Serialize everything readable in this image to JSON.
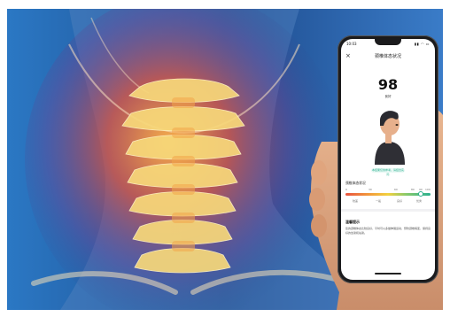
{
  "app": {
    "status_time": "10:03",
    "status_icons": "▮▮ ◠ ▭",
    "close_glyph": "×",
    "title": "颈椎体态状况",
    "score": "98",
    "score_label": "良好",
    "assess_note": "本结果仅供参考，请结合实际",
    "meter": {
      "title": "颈椎体态状况",
      "ticks": [
        "0",
        "30",
        "60",
        "80",
        "90",
        "100"
      ],
      "labels": [
        "较差",
        "一般",
        "良好",
        "优秀"
      ],
      "value": 98,
      "colors": [
        "#e8533f",
        "#f29a3b",
        "#f2d13f",
        "#86c96b",
        "#2bb08f"
      ]
    },
    "tips_title": "温馨提示",
    "tips_body": "您的颈椎体态比较良好，平时可以多做伸展运动，预防颈椎病变，保持良好的坐姿和站姿。"
  },
  "colors": {
    "background": "#1e4f94",
    "accent": "#2bb08f"
  },
  "icons": [
    "close-icon",
    "person-profile-figure"
  ]
}
